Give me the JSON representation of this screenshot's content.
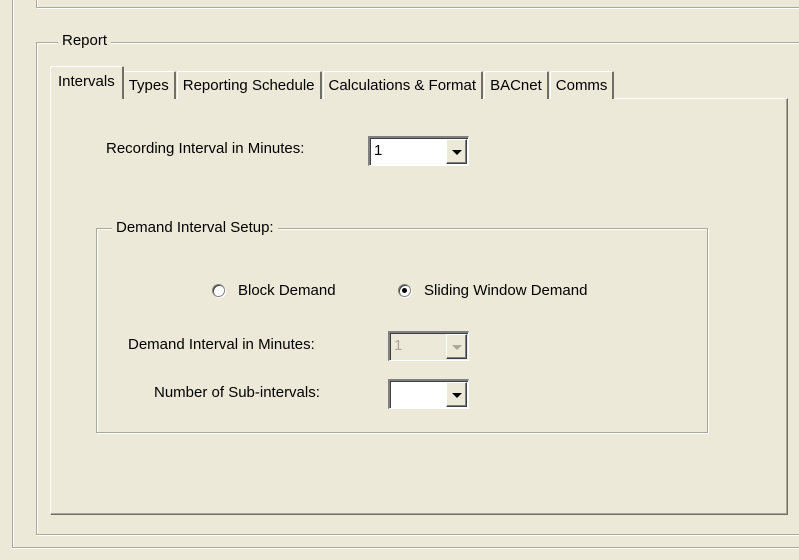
{
  "group": {
    "label": "Report"
  },
  "tabs": [
    {
      "label": "Intervals",
      "active": true
    },
    {
      "label": "Types"
    },
    {
      "label": "Reporting Schedule"
    },
    {
      "label": "Calculations & Format"
    },
    {
      "label": "BACnet"
    },
    {
      "label": "Comms"
    }
  ],
  "recording": {
    "label": "Recording Interval in Minutes:",
    "value": "1"
  },
  "demand": {
    "group_label": "Demand Interval Setup:",
    "radios": [
      {
        "label": "Block Demand",
        "checked": false
      },
      {
        "label": "Sliding Window Demand",
        "checked": true
      }
    ],
    "interval": {
      "label": "Demand Interval in Minutes:",
      "value": "1",
      "disabled": true
    },
    "subintervals": {
      "label": "Number of Sub-intervals:",
      "value": ""
    }
  }
}
